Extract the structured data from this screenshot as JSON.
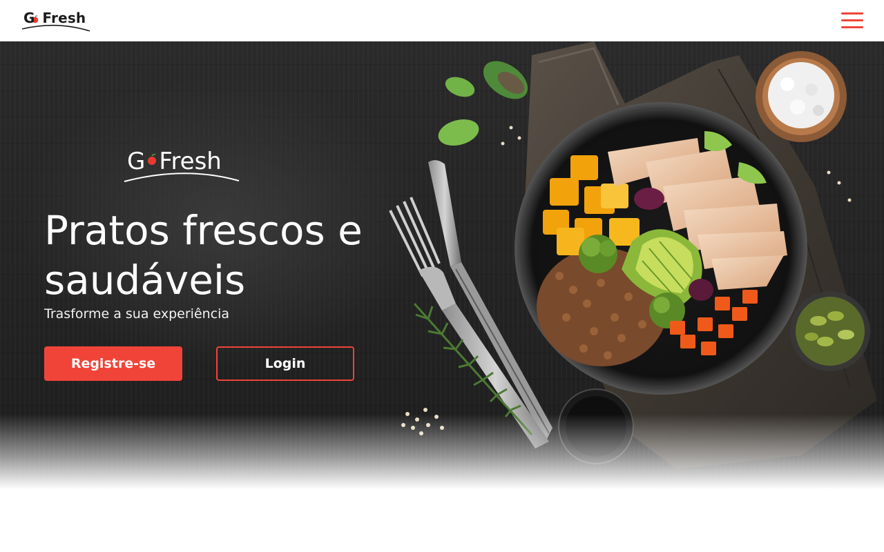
{
  "header": {
    "logo_text": "GoFresh",
    "menu_icon": "hamburger-menu-icon"
  },
  "hero": {
    "logo_text": "GoFresh",
    "headline": "Pratos frescos e saudáveis",
    "subtitle": "Trasforme a sua experiência",
    "register_button": "Registre-se",
    "login_button": "Login",
    "image_description_icon": "food-bowl-image"
  },
  "colors": {
    "accent": "#f04438",
    "hero_background": "#242424",
    "header_background": "#ffffff"
  }
}
